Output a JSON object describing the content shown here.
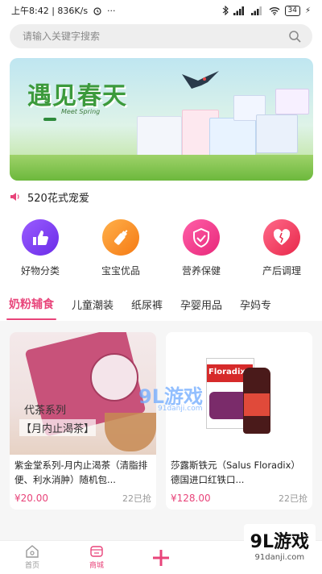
{
  "status_bar": {
    "time_speed": "上午8:42 | 836K/s",
    "battery": "34"
  },
  "search": {
    "placeholder": "请输入关键字搜索"
  },
  "banner": {
    "title": "遇见春天",
    "subtitle": "Meet Spring"
  },
  "notice": {
    "text": "520花式宠爱"
  },
  "categories": [
    {
      "label": "好物分类",
      "icon": "thumbs-up-icon",
      "color": "#7a3cf0"
    },
    {
      "label": "宝宝优品",
      "icon": "baby-bottle-icon",
      "color": "#f58a22"
    },
    {
      "label": "营养保健",
      "icon": "shield-check-icon",
      "color": "#e83a8a"
    },
    {
      "label": "产后调理",
      "icon": "heart-icon",
      "color": "#e83a5a"
    }
  ],
  "tabs": [
    {
      "label": "奶粉辅食"
    },
    {
      "label": "儿童潮装"
    },
    {
      "label": "纸尿裤"
    },
    {
      "label": "孕婴用品"
    },
    {
      "label": "孕妈专"
    }
  ],
  "products": [
    {
      "name": "紫金堂系列-月内止渴茶（清脂排便、利水消肿）随机包...",
      "price": "¥20.00",
      "sold": "22已抢",
      "img_line1": "代茶系列",
      "img_line2": "【月内止渴茶】"
    },
    {
      "name": "莎露斯铁元（Salus Floradix）德国进口红铁口...",
      "price": "¥128.00",
      "sold": "22已抢",
      "img_brand": "Floradix"
    }
  ],
  "bottom_nav": [
    {
      "label": "首页",
      "icon": "home-icon"
    },
    {
      "label": "商城",
      "icon": "shop-icon"
    },
    {
      "label": "",
      "icon": "plus-icon"
    }
  ],
  "watermark": {
    "main": "9L游戏",
    "sub": "91danji.com"
  },
  "colors": {
    "accent": "#e8447a"
  }
}
